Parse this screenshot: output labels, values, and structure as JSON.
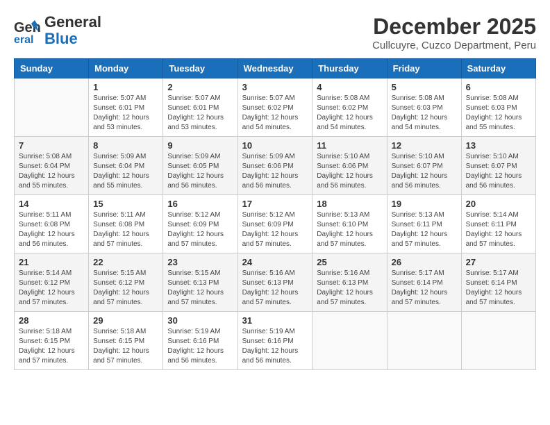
{
  "header": {
    "logo_line1": "General",
    "logo_line2": "Blue",
    "month": "December 2025",
    "location": "Cullcuyre, Cuzco Department, Peru"
  },
  "weekdays": [
    "Sunday",
    "Monday",
    "Tuesday",
    "Wednesday",
    "Thursday",
    "Friday",
    "Saturday"
  ],
  "weeks": [
    [
      {
        "day": "",
        "info": ""
      },
      {
        "day": "1",
        "info": "Sunrise: 5:07 AM\nSunset: 6:01 PM\nDaylight: 12 hours\nand 53 minutes."
      },
      {
        "day": "2",
        "info": "Sunrise: 5:07 AM\nSunset: 6:01 PM\nDaylight: 12 hours\nand 53 minutes."
      },
      {
        "day": "3",
        "info": "Sunrise: 5:07 AM\nSunset: 6:02 PM\nDaylight: 12 hours\nand 54 minutes."
      },
      {
        "day": "4",
        "info": "Sunrise: 5:08 AM\nSunset: 6:02 PM\nDaylight: 12 hours\nand 54 minutes."
      },
      {
        "day": "5",
        "info": "Sunrise: 5:08 AM\nSunset: 6:03 PM\nDaylight: 12 hours\nand 54 minutes."
      },
      {
        "day": "6",
        "info": "Sunrise: 5:08 AM\nSunset: 6:03 PM\nDaylight: 12 hours\nand 55 minutes."
      }
    ],
    [
      {
        "day": "7",
        "info": "Sunrise: 5:08 AM\nSunset: 6:04 PM\nDaylight: 12 hours\nand 55 minutes."
      },
      {
        "day": "8",
        "info": "Sunrise: 5:09 AM\nSunset: 6:04 PM\nDaylight: 12 hours\nand 55 minutes."
      },
      {
        "day": "9",
        "info": "Sunrise: 5:09 AM\nSunset: 6:05 PM\nDaylight: 12 hours\nand 56 minutes."
      },
      {
        "day": "10",
        "info": "Sunrise: 5:09 AM\nSunset: 6:06 PM\nDaylight: 12 hours\nand 56 minutes."
      },
      {
        "day": "11",
        "info": "Sunrise: 5:10 AM\nSunset: 6:06 PM\nDaylight: 12 hours\nand 56 minutes."
      },
      {
        "day": "12",
        "info": "Sunrise: 5:10 AM\nSunset: 6:07 PM\nDaylight: 12 hours\nand 56 minutes."
      },
      {
        "day": "13",
        "info": "Sunrise: 5:10 AM\nSunset: 6:07 PM\nDaylight: 12 hours\nand 56 minutes."
      }
    ],
    [
      {
        "day": "14",
        "info": "Sunrise: 5:11 AM\nSunset: 6:08 PM\nDaylight: 12 hours\nand 56 minutes."
      },
      {
        "day": "15",
        "info": "Sunrise: 5:11 AM\nSunset: 6:08 PM\nDaylight: 12 hours\nand 57 minutes."
      },
      {
        "day": "16",
        "info": "Sunrise: 5:12 AM\nSunset: 6:09 PM\nDaylight: 12 hours\nand 57 minutes."
      },
      {
        "day": "17",
        "info": "Sunrise: 5:12 AM\nSunset: 6:09 PM\nDaylight: 12 hours\nand 57 minutes."
      },
      {
        "day": "18",
        "info": "Sunrise: 5:13 AM\nSunset: 6:10 PM\nDaylight: 12 hours\nand 57 minutes."
      },
      {
        "day": "19",
        "info": "Sunrise: 5:13 AM\nSunset: 6:11 PM\nDaylight: 12 hours\nand 57 minutes."
      },
      {
        "day": "20",
        "info": "Sunrise: 5:14 AM\nSunset: 6:11 PM\nDaylight: 12 hours\nand 57 minutes."
      }
    ],
    [
      {
        "day": "21",
        "info": "Sunrise: 5:14 AM\nSunset: 6:12 PM\nDaylight: 12 hours\nand 57 minutes."
      },
      {
        "day": "22",
        "info": "Sunrise: 5:15 AM\nSunset: 6:12 PM\nDaylight: 12 hours\nand 57 minutes."
      },
      {
        "day": "23",
        "info": "Sunrise: 5:15 AM\nSunset: 6:13 PM\nDaylight: 12 hours\nand 57 minutes."
      },
      {
        "day": "24",
        "info": "Sunrise: 5:16 AM\nSunset: 6:13 PM\nDaylight: 12 hours\nand 57 minutes."
      },
      {
        "day": "25",
        "info": "Sunrise: 5:16 AM\nSunset: 6:13 PM\nDaylight: 12 hours\nand 57 minutes."
      },
      {
        "day": "26",
        "info": "Sunrise: 5:17 AM\nSunset: 6:14 PM\nDaylight: 12 hours\nand 57 minutes."
      },
      {
        "day": "27",
        "info": "Sunrise: 5:17 AM\nSunset: 6:14 PM\nDaylight: 12 hours\nand 57 minutes."
      }
    ],
    [
      {
        "day": "28",
        "info": "Sunrise: 5:18 AM\nSunset: 6:15 PM\nDaylight: 12 hours\nand 57 minutes."
      },
      {
        "day": "29",
        "info": "Sunrise: 5:18 AM\nSunset: 6:15 PM\nDaylight: 12 hours\nand 57 minutes."
      },
      {
        "day": "30",
        "info": "Sunrise: 5:19 AM\nSunset: 6:16 PM\nDaylight: 12 hours\nand 56 minutes."
      },
      {
        "day": "31",
        "info": "Sunrise: 5:19 AM\nSunset: 6:16 PM\nDaylight: 12 hours\nand 56 minutes."
      },
      {
        "day": "",
        "info": ""
      },
      {
        "day": "",
        "info": ""
      },
      {
        "day": "",
        "info": ""
      }
    ]
  ]
}
